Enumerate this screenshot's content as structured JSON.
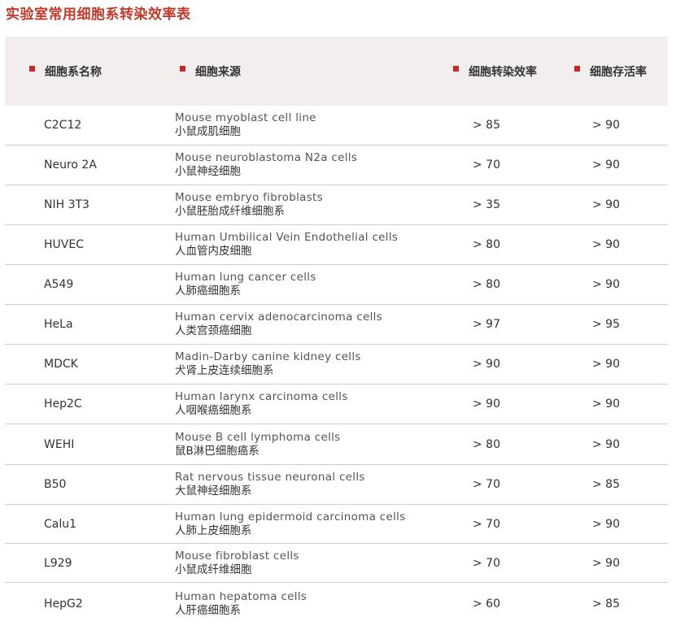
{
  "title": "实验室常用细胞系转染效率表",
  "headers": [
    "细胞系名称",
    "细胞来源",
    "细胞转染效率",
    "细胞存活率"
  ],
  "rows": [
    {
      "name": "C2C12",
      "source_en": "Mouse myoblast cell line",
      "source_cn": "小鼠成肌细胞",
      "efficiency": "> 85",
      "viability": "> 90"
    },
    {
      "name": "Neuro 2A",
      "source_en": "Mouse neuroblastoma  N2a cells",
      "source_cn": "小鼠神经细胞",
      "efficiency": "> 70",
      "viability": "> 90"
    },
    {
      "name": "NIH 3T3",
      "source_en": "Mouse embryo fibroblasts",
      "source_cn": "小鼠胚胎成纤维细胞系",
      "efficiency": "> 35",
      "viability": "> 90"
    },
    {
      "name": "HUVEC",
      "source_en": "Human Umbilical Vein Endothelial cells",
      "source_cn": "人血管内皮细胞",
      "efficiency": "> 80",
      "viability": "> 90"
    },
    {
      "name": "A549",
      "source_en": "Human lung cancer cells",
      "source_cn": "人肺癌细胞系",
      "efficiency": "> 80",
      "viability": "> 90"
    },
    {
      "name": "HeLa",
      "source_en": "Human cervix adenocarcinoma cells",
      "source_cn": "人类宫颈癌细胞",
      "efficiency": "> 97",
      "viability": "> 95"
    },
    {
      "name": "MDCK",
      "source_en": "Madin-Darby canine kidney cells",
      "source_cn": "犬肾上皮连续细胞系",
      "efficiency": "> 90",
      "viability": "> 90"
    },
    {
      "name": "Hep2C",
      "source_en": "Human larynx carcinoma cells",
      "source_cn": "人咽喉癌细胞系",
      "efficiency": "> 90",
      "viability": "> 90"
    },
    {
      "name": "WEHI",
      "source_en": "Mouse B cell lymphoma cells",
      "source_cn": "鼠B淋巴细胞癌系",
      "efficiency": "> 80",
      "viability": "> 90"
    },
    {
      "name": "B50",
      "source_en": "Rat nervous tissue neuronal cells",
      "source_cn": "大鼠神经细胞系",
      "efficiency": "> 70",
      "viability": "> 85"
    },
    {
      "name": "Calu1",
      "source_en": "Human lung epidermoid carcinoma cells",
      "source_cn": "人肺上皮细胞系",
      "efficiency": "> 70",
      "viability": "> 90"
    },
    {
      "name": "L929",
      "source_en": "Mouse fibroblast cells",
      "source_cn": "小鼠成纤维细胞",
      "efficiency": "> 70",
      "viability": "> 90"
    },
    {
      "name": "HepG2",
      "source_en": "Human hepatoma cells",
      "source_cn": "人肝癌细胞系",
      "efficiency": "> 60",
      "viability": "> 85"
    }
  ],
  "colors": {
    "accent": "#c62828",
    "title": "#c0392b",
    "header_bg": "#f2eeee",
    "divider": "#cfcfcf"
  }
}
